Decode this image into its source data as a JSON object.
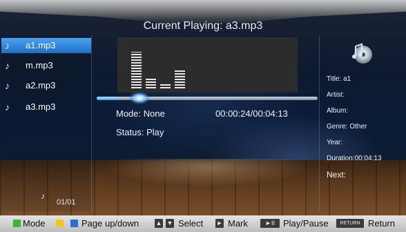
{
  "header": {
    "title": "Current Playing: a3.mp3"
  },
  "playlist": {
    "items": [
      {
        "label": "a1.mp3",
        "selected": true
      },
      {
        "label": "m.mp3",
        "selected": false
      },
      {
        "label": "a2.mp3",
        "selected": false
      },
      {
        "label": "a3.mp3",
        "selected": false
      }
    ],
    "page": "01/01"
  },
  "player": {
    "mode": "Mode: None",
    "status": "Status: Play",
    "time": "00:00:24/00:04:13",
    "progress_fraction": 0.095,
    "equalizer_levels": [
      0.78,
      0.2,
      0.12,
      0.38
    ]
  },
  "info": {
    "title": "Title: a1",
    "artist": "Artist:",
    "album": "Album:",
    "genre": "Genre: Other",
    "year": "Year:",
    "duration": "Duration:00:04:13",
    "next": "Next:"
  },
  "footer": {
    "mode": "Mode",
    "page": "Page up/down",
    "up_arrow": "▲",
    "down_arrow": "▼",
    "select": "Select",
    "mark_icon": "►",
    "mark": "Mark",
    "playpause_icon": "►II",
    "playpause": "Play/Pause",
    "return_key": "RETURN",
    "return": "Return"
  },
  "colors": {
    "green": "#3cb43c",
    "yellow": "#f0c81e",
    "blue": "#2a6fd6",
    "selection": "#2a7fd8"
  }
}
